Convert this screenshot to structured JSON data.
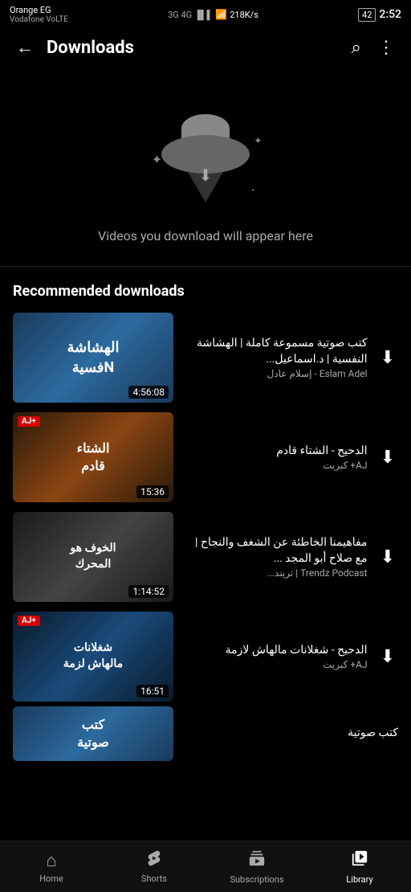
{
  "statusBar": {
    "carrier": "Orange EG",
    "network": "Vodafone VoLTE",
    "signal": "3G 4G",
    "speed": "218K/s",
    "battery": "42",
    "time": "2:52"
  },
  "header": {
    "title": "Downloads",
    "back_label": "←",
    "search_label": "⌕",
    "more_label": "⋮"
  },
  "emptyState": {
    "message": "Videos you download will appear here"
  },
  "recommendedSection": {
    "title": "Recommended downloads"
  },
  "videos": [
    {
      "id": 1,
      "title": "كتب صوتية مسموعة كاملة | الهشاشة النفسية | د.اسماعيل...",
      "channel": "Eslam Adel - إسلام عادل",
      "duration": "4:56:08",
      "thumb_class": "thumb-1",
      "has_aj": false
    },
    {
      "id": 2,
      "title": "الدحيح - الشتاء قادم",
      "channel": "AJ+ كبريت",
      "duration": "15:36",
      "thumb_class": "thumb-2",
      "has_aj": true
    },
    {
      "id": 3,
      "title": "مفاهيمنا الخاطئة عن الشغف والنجاح | مع صلاح أبو المجد ...",
      "channel": "Trendz Podcast | تريند...",
      "duration": "1:14:52",
      "thumb_class": "thumb-3",
      "has_aj": false
    },
    {
      "id": 4,
      "title": "الدحيح - شغلانات مالهاش لازمة",
      "channel": "AJ+ كبريت",
      "duration": "16:51",
      "thumb_class": "thumb-4",
      "has_aj": true
    },
    {
      "id": 5,
      "title": "كتب صوتية",
      "channel": "",
      "duration": "",
      "thumb_class": "thumb-5",
      "has_aj": false
    }
  ],
  "bottomNav": {
    "items": [
      {
        "id": "home",
        "label": "Home",
        "icon": "⌂",
        "active": false
      },
      {
        "id": "shorts",
        "label": "Shorts",
        "icon": "▶",
        "active": false
      },
      {
        "id": "subscriptions",
        "label": "Subscriptions",
        "icon": "▦",
        "active": false
      },
      {
        "id": "library",
        "label": "Library",
        "icon": "▷",
        "active": true
      }
    ]
  }
}
